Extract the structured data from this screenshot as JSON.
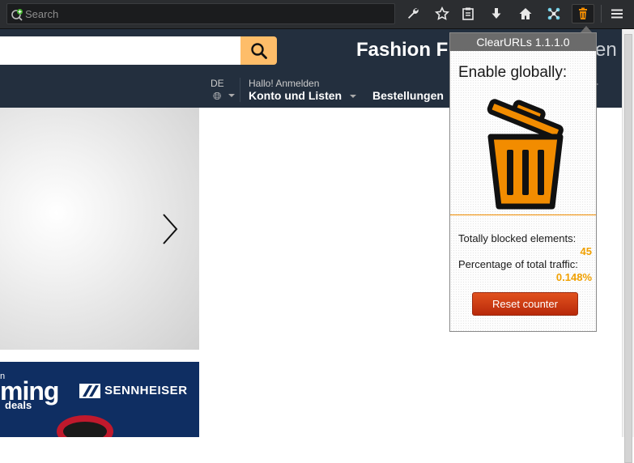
{
  "browser": {
    "search_placeholder": "Search",
    "toolbar_icons": [
      "wrench-icon",
      "star-icon",
      "clipboard-icon",
      "download-icon",
      "home-icon",
      "puzzle-icon",
      "trash-icon",
      "hamburger-icon"
    ]
  },
  "page": {
    "promo_text": "Fashion Fi",
    "promo_tail": "en",
    "language_code": "DE",
    "greeting": "Hallo! Anmelden",
    "account_label": "Konto und Listen",
    "orders_label": "Bestellungen",
    "nav_tail": "-",
    "ad": {
      "top_text": "n",
      "headline": "ming",
      "sub": "deals",
      "brand": "SENNHEISER"
    }
  },
  "popup": {
    "title": "ClearURLs 1.1.1.0",
    "enable_label": "Enable globally:",
    "blocked_label": "Totally blocked elements:",
    "blocked_value": "45",
    "traffic_label": "Percentage of total traffic:",
    "traffic_value": "0.148%",
    "reset_label": "Reset counter"
  },
  "colors": {
    "accent_orange": "#f28c00",
    "header_navy": "#232f3e",
    "search_button": "#febd69",
    "stat_value": "#f0a000",
    "reset_button": "#c93b14"
  }
}
